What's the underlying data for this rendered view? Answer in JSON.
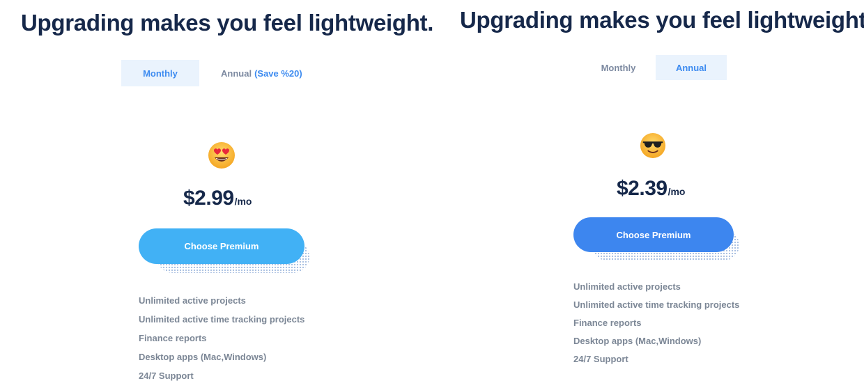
{
  "panels": [
    {
      "headline": "Upgrading makes you feel lightweight.",
      "toggle": {
        "monthly": "Monthly",
        "annual": "Annual",
        "save": "(Save %20)",
        "active": "monthly"
      },
      "emoji": "heart-eyes-emoji",
      "price": {
        "amount": "$2.99",
        "unit": "/mo"
      },
      "cta": "Choose Premium",
      "cta_color": "#41b1f5",
      "features": [
        "Unlimited active projects",
        "Unlimited active time tracking projects",
        "Finance reports",
        "Desktop apps (Mac,Windows)",
        "24/7 Support"
      ]
    },
    {
      "headline": "Upgrading makes you feel lightweight.",
      "toggle": {
        "monthly": "Monthly",
        "annual": "Annual",
        "active": "annual"
      },
      "emoji": "sunglasses-emoji",
      "price": {
        "amount": "$2.39",
        "unit": "/mo"
      },
      "cta": "Choose Premium",
      "cta_color": "#3d86ef",
      "features": [
        "Unlimited active projects",
        "Unlimited active time tracking projects",
        "Finance reports",
        "Desktop apps (Mac,Windows)",
        "24/7 Support"
      ]
    }
  ],
  "colors": {
    "accent": "#3d8bf0",
    "title": "#16284a",
    "muted": "#7c8796",
    "toggle_active_bg": "#eaf3fd"
  }
}
